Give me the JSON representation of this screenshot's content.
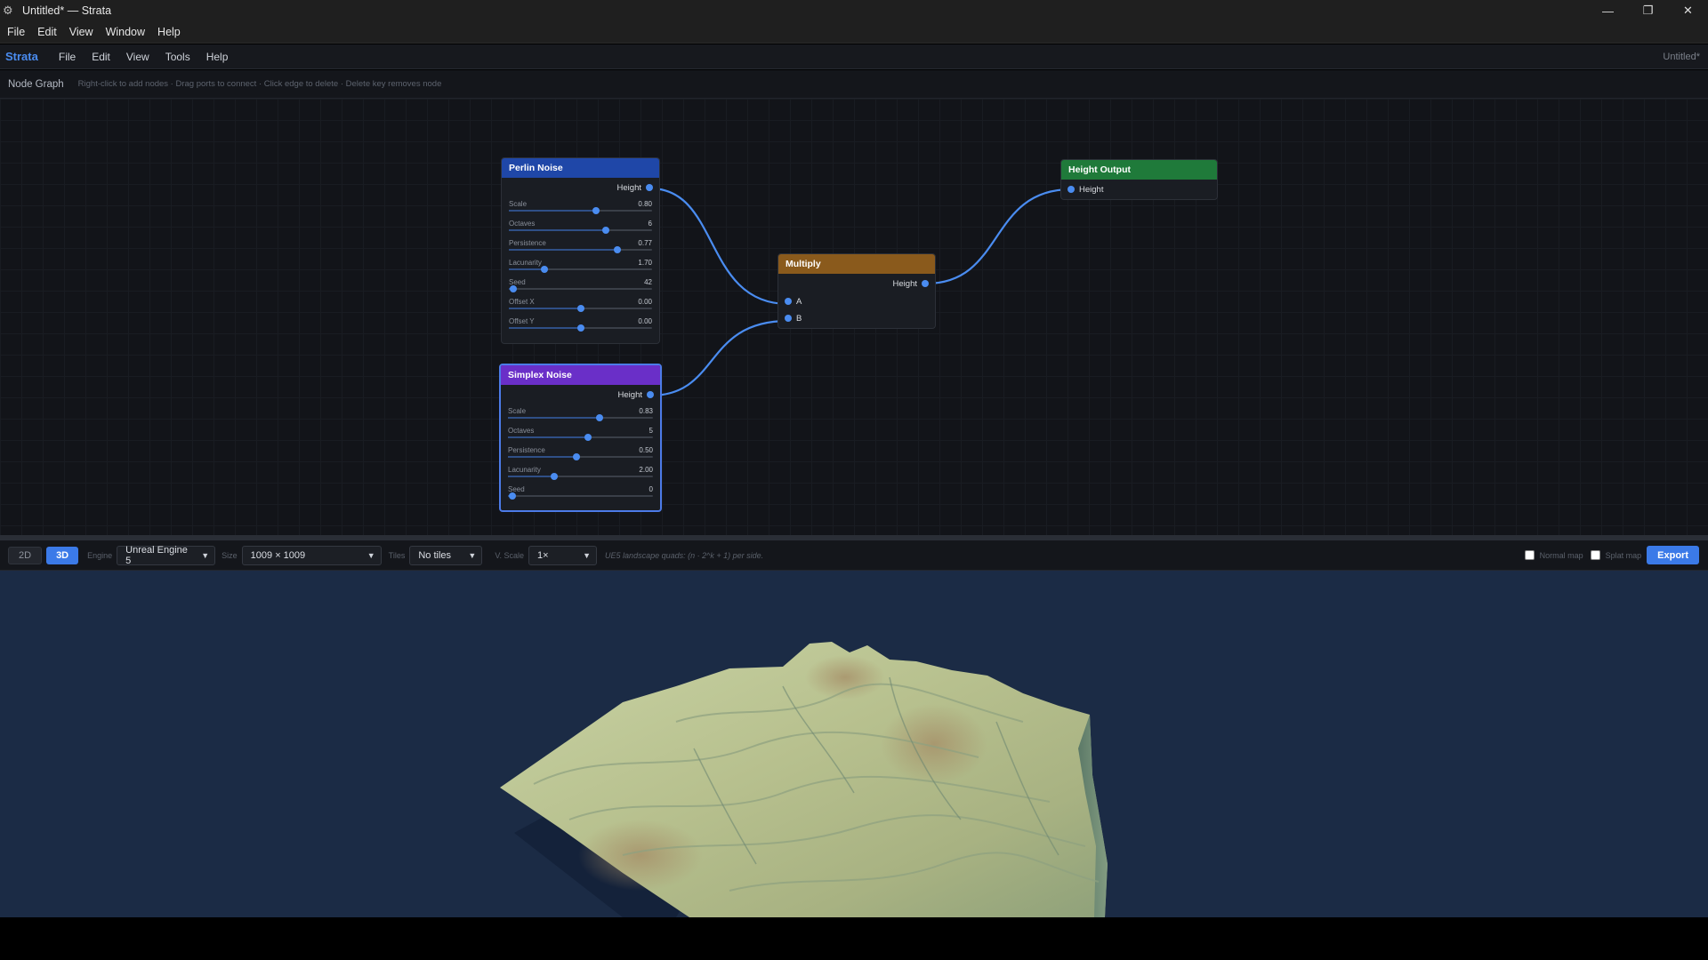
{
  "window": {
    "title": "Untitled* — Strata",
    "controls": {
      "minimize": "—",
      "maximize": "❐",
      "close": "✕"
    }
  },
  "window_menu": [
    "File",
    "Edit",
    "View",
    "Window",
    "Help"
  ],
  "app_menu": {
    "brand": "Strata",
    "items": [
      "File",
      "Edit",
      "View",
      "Tools",
      "Help"
    ],
    "document": "Untitled*"
  },
  "graph": {
    "title": "Node Graph",
    "hint": "Right-click to add nodes · Drag ports to connect · Click edge to delete · Delete key removes node"
  },
  "nodes": {
    "perlin": {
      "title": "Perlin Noise",
      "color": "#1f47a8",
      "output": "Height",
      "params": [
        {
          "label": "Scale",
          "value": "0.80",
          "fraction": 0.61
        },
        {
          "label": "Octaves",
          "value": "6",
          "fraction": 0.68
        },
        {
          "label": "Persistence",
          "value": "0.77",
          "fraction": 0.76
        },
        {
          "label": "Lacunarity",
          "value": "1.70",
          "fraction": 0.25
        },
        {
          "label": "Seed",
          "value": "42",
          "fraction": 0.03
        },
        {
          "label": "Offset X",
          "value": "0.00",
          "fraction": 0.5
        },
        {
          "label": "Offset Y",
          "value": "0.00",
          "fraction": 0.5
        }
      ]
    },
    "simplex": {
      "title": "Simplex Noise",
      "color": "#6a2fc8",
      "output": "Height",
      "params": [
        {
          "label": "Scale",
          "value": "0.83",
          "fraction": 0.63
        },
        {
          "label": "Octaves",
          "value": "5",
          "fraction": 0.55
        },
        {
          "label": "Persistence",
          "value": "0.50",
          "fraction": 0.47
        },
        {
          "label": "Lacunarity",
          "value": "2.00",
          "fraction": 0.32
        },
        {
          "label": "Seed",
          "value": "0",
          "fraction": 0.03
        }
      ]
    },
    "multiply": {
      "title": "Multiply",
      "color": "#8a5a1c",
      "output": "Height",
      "inputs": [
        "A",
        "B"
      ]
    },
    "output": {
      "title": "Height Output",
      "color": "#1f7a3a",
      "inputs": [
        "Height"
      ]
    }
  },
  "viewport_toolbar": {
    "mode_2d": "2D",
    "mode_3d": "3D",
    "engine_label": "Engine",
    "engine_value": "Unreal Engine 5",
    "size_label": "Size",
    "size_value": "1009 × 1009",
    "tiles_label": "Tiles",
    "tiles_value": "No tiles",
    "vscale_label": "V. Scale",
    "vscale_value": "1×",
    "note": "UE5 landscape quads: (n · 2^k + 1) per side.",
    "normal_map": "Normal map",
    "splat_map": "Splat map",
    "export": "Export"
  }
}
